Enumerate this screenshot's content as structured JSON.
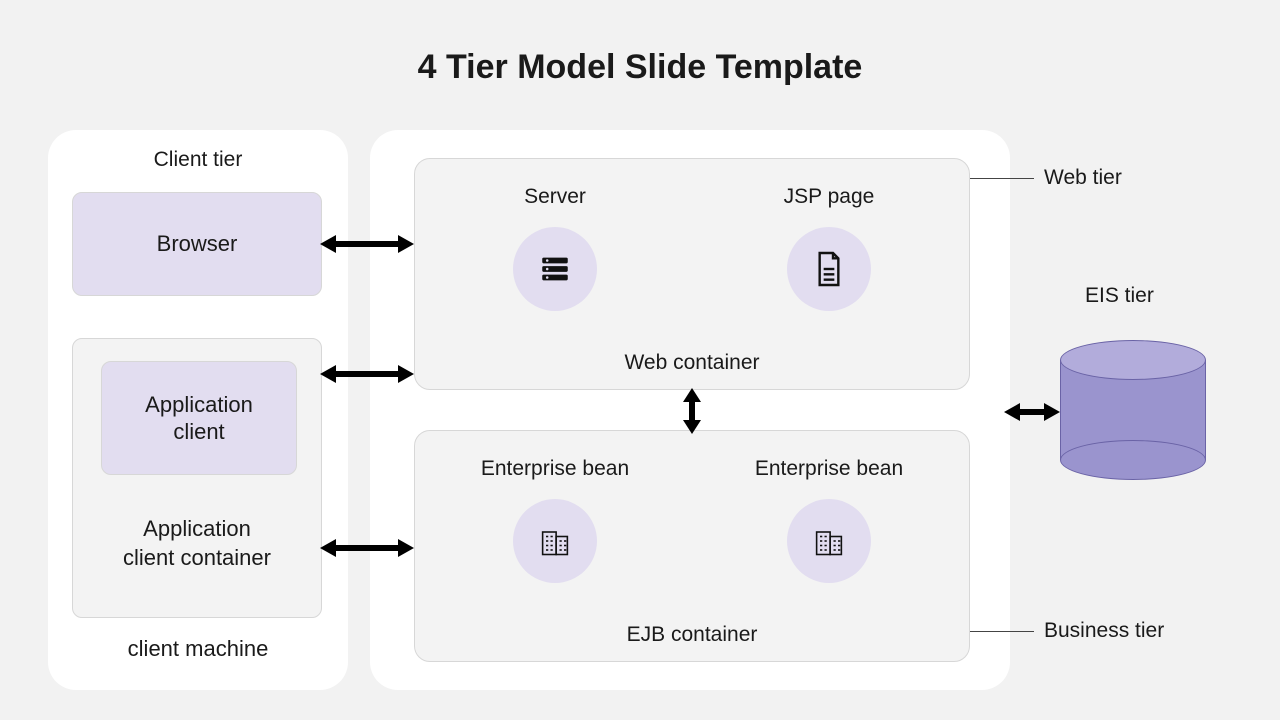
{
  "title": "4 Tier Model Slide Template",
  "client": {
    "title": "Client tier",
    "browser": "Browser",
    "app_client": "Application\nclient",
    "app_client_container": "Application\nclient container",
    "machine": "client machine"
  },
  "web": {
    "label": "Web tier",
    "container": "Web container",
    "server": "Server",
    "jsp": "JSP page"
  },
  "ejb": {
    "label": "Business tier",
    "container": "EJB container",
    "bean1": "Enterprise bean",
    "bean2": "Enterprise bean"
  },
  "eis": {
    "label": "EIS tier"
  }
}
